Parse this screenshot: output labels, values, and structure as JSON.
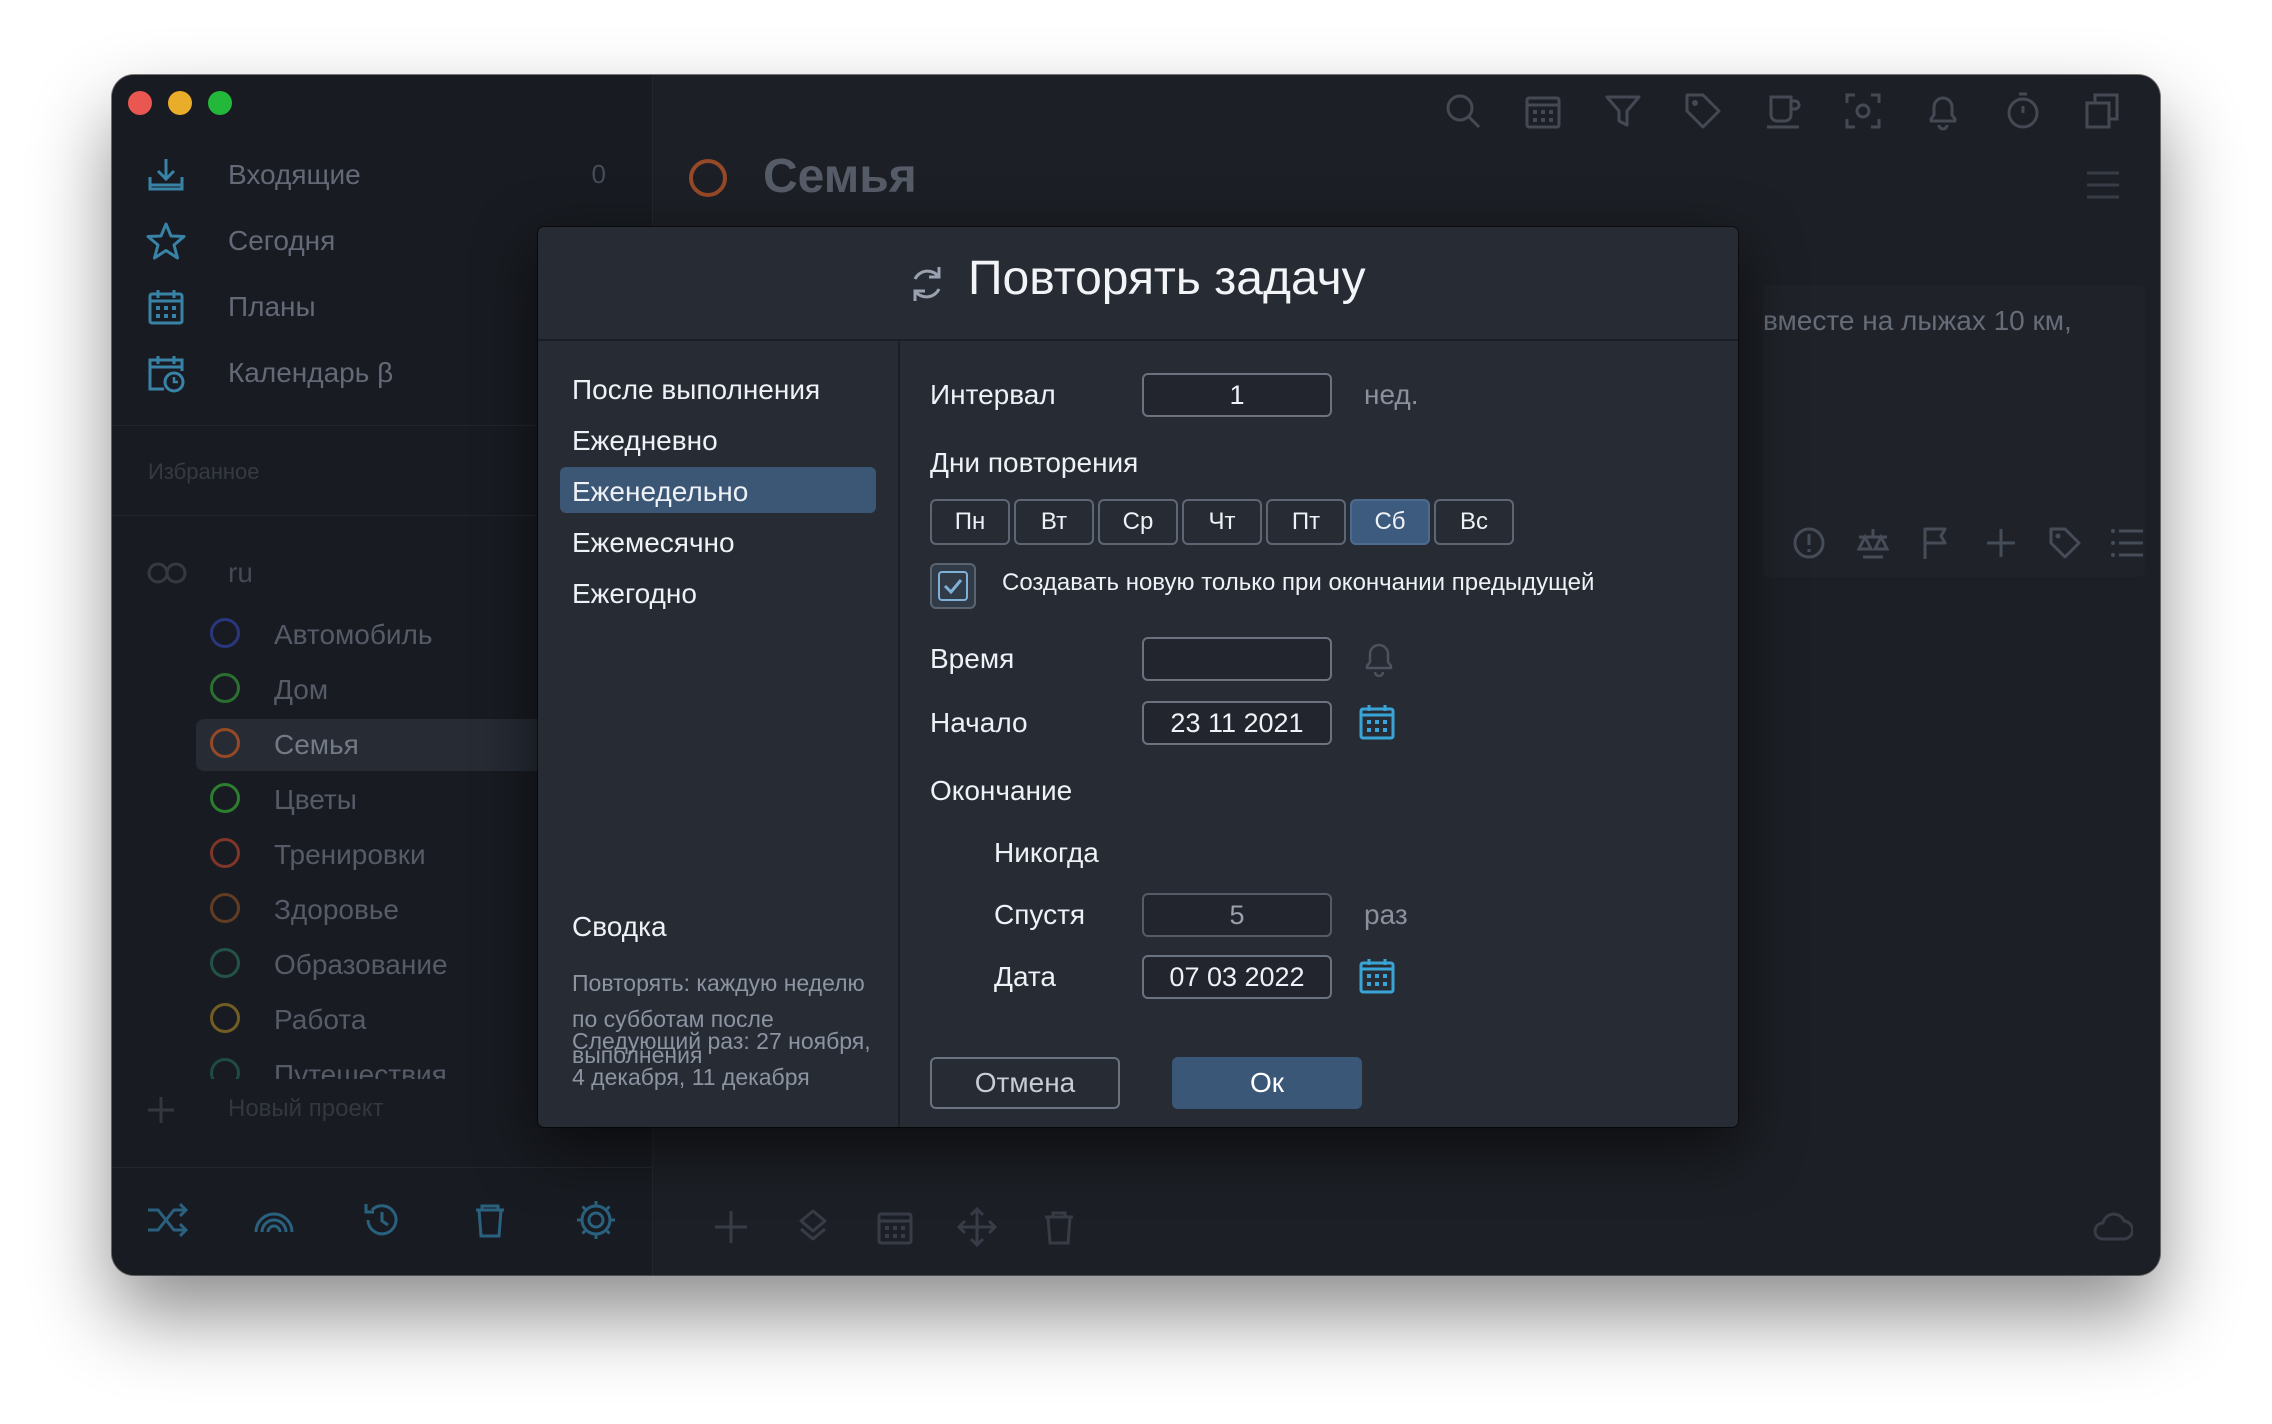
{
  "sidebar": {
    "nav": [
      {
        "label": "Входящие",
        "count": "0",
        "icon": "inbox-icon"
      },
      {
        "label": "Сегодня",
        "icon": "star-icon"
      },
      {
        "label": "Планы",
        "icon": "calendar-grid-icon"
      },
      {
        "label": "Календарь β",
        "icon": "calendar-clock-icon"
      }
    ],
    "favorites_label": "Избранное",
    "group_label": "ru",
    "projects": [
      {
        "label": "Автомобиль",
        "color": "#2d3c8a"
      },
      {
        "label": "Дом",
        "color": "#2d7a36"
      },
      {
        "label": "Семья",
        "color": "#a2502a"
      },
      {
        "label": "Цветы",
        "color": "#2f8a32"
      },
      {
        "label": "Тренировки",
        "color": "#8a3a2c"
      },
      {
        "label": "Здоровье",
        "color": "#6a4326"
      },
      {
        "label": "Образование",
        "color": "#265a4e"
      },
      {
        "label": "Работа",
        "color": "#7c6726"
      },
      {
        "label": "Путешествия",
        "color": "#21524c"
      }
    ],
    "new_project": "Новый проект"
  },
  "main": {
    "title": "Семья",
    "task_text": "вместе на лыжах 10 км,"
  },
  "dialog": {
    "title": "Повторять задачу",
    "types": [
      "После выполнения",
      "Ежедневно",
      "Еженедельно",
      "Ежемесячно",
      "Ежегодно"
    ],
    "selected_type": "Еженедельно",
    "summary_heading": "Сводка",
    "summary_text": "Повторять: каждую неделю по субботам после выполнения",
    "next_text": "Следующий раз: 27 ноября, 4 декабря, 11 декабря",
    "interval_label": "Интервал",
    "interval_value": "1",
    "interval_unit": "нед.",
    "days_label": "Дни повторения",
    "days": [
      "Пн",
      "Вт",
      "Ср",
      "Чт",
      "Пт",
      "Сб",
      "Вс"
    ],
    "selected_day": "Сб",
    "checkbox_label": "Создавать новую только при окончании предыдущей",
    "checkbox_checked": true,
    "time_label": "Время",
    "time_value": "",
    "start_label": "Начало",
    "start_value": "23 11 2021",
    "end_label": "Окончание",
    "never_label": "Никогда",
    "after_label": "Спустя",
    "after_value": "5",
    "after_unit": "раз",
    "date_label": "Дата",
    "date_value": "07 03 2022",
    "cancel_label": "Отмена",
    "ok_label": "Ок"
  },
  "colors": {
    "accent": "#3b5778",
    "icon_blue": "#38a5d6",
    "dialog_bg": "#272b34"
  }
}
